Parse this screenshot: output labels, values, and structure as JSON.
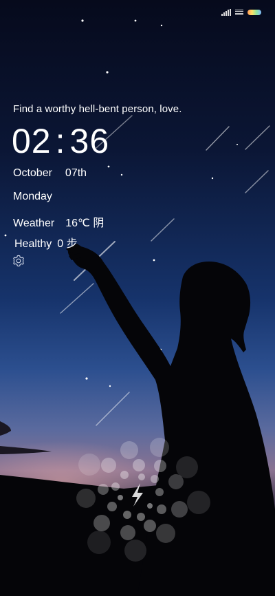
{
  "status_bar": {
    "icons": [
      "signal-icon",
      "wifi-icon",
      "battery-icon"
    ]
  },
  "lockscreen": {
    "quote": "Find a worthy hell-bent person, love.",
    "time": {
      "hours": "02",
      "separator": ":",
      "minutes": "36"
    },
    "date": {
      "month": "October",
      "day": "07th"
    },
    "weekday": "Monday",
    "weather": {
      "label": "Weather",
      "value": "16℃ 阴"
    },
    "health": {
      "label": "Healthy",
      "value": "0 步"
    }
  },
  "icons": {
    "settings": "gear-icon",
    "charging": "lightning-icon"
  }
}
